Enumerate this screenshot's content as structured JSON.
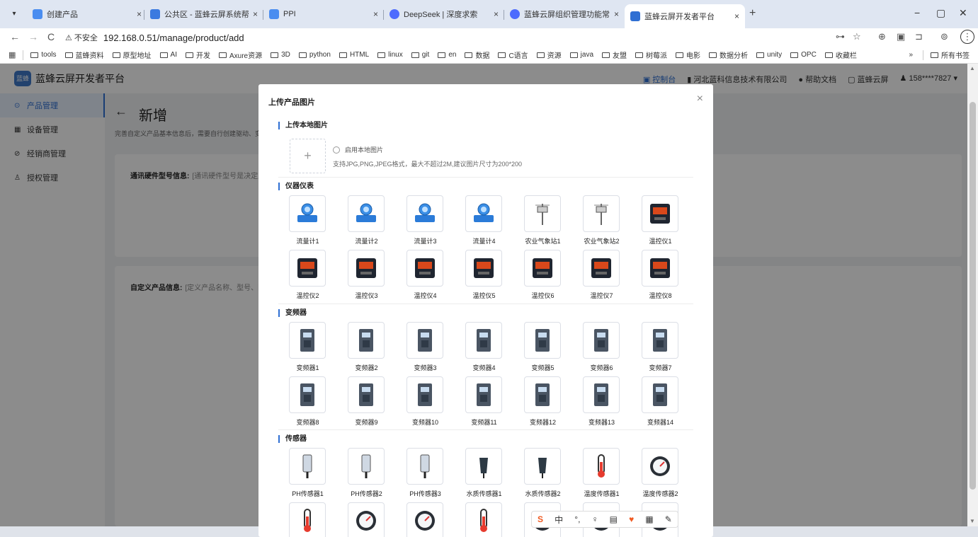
{
  "browser": {
    "tabs": [
      {
        "label": "创建产品",
        "color": "#4a8df0"
      },
      {
        "label": "公共区 - 蓝蜂云屏系统帮助中心",
        "color": "#3b7ae0"
      },
      {
        "label": "PPI",
        "color": "#4a8df0"
      },
      {
        "label": "DeepSeek | 深度求索",
        "color": "#4d6bfe"
      },
      {
        "label": "蓝蜂云屏组织管理功能常见问题",
        "color": "#4d6bfe"
      },
      {
        "label": "蓝蜂云屏开发者平台",
        "color": "#2f6fd3"
      }
    ],
    "tab_close": "×",
    "new_tab": "+",
    "win_min": "−",
    "win_max": "▢",
    "win_close": "✕",
    "back": "←",
    "forward": "→",
    "reload": "C",
    "insecure_label": "不安全",
    "url": "192.168.0.51/manage/product/add",
    "bookmarks": [
      "tools",
      "蓝蜂资料",
      "原型地址",
      "AI",
      "开发",
      "Axure资源",
      "3D",
      "python",
      "HTML",
      "linux",
      "git",
      "en",
      "数据",
      "C语言",
      "资源",
      "java",
      "友盟",
      "树莓派",
      "电影",
      "数据分析",
      "unity",
      "OPC",
      "收藏栏"
    ],
    "bookmarks_more": "»",
    "all_bookmarks": "所有书签"
  },
  "app": {
    "title": "蓝蜂云屏开发者平台",
    "logo_text": "蓝蜂",
    "header_links": {
      "console": "控制台",
      "company": "河北蓝科信息技术有限公司",
      "help": "帮助文档",
      "cloud": "蓝蜂云屏",
      "user": "158****7827"
    },
    "sidebar": [
      {
        "label": "产品管理",
        "icon": "⊙"
      },
      {
        "label": "设备管理",
        "icon": "▦"
      },
      {
        "label": "经销商管理",
        "icon": "⊘"
      },
      {
        "label": "授权管理",
        "icon": "♙"
      }
    ],
    "page": {
      "back": "←",
      "title": "新增",
      "desc": "完善自定义产品基本信息后，需要自行创建驱动、变量",
      "section1_label": "通讯硬件型号信息:",
      "section1_hint": "[通讯硬件型号是决定产品",
      "section2_label": "自定义产品信息:",
      "section2_hint": "[定义产品名称、型号、图片"
    }
  },
  "modal": {
    "title": "上传产品图片",
    "close": "×",
    "local_section": "上传本地图片",
    "upload_plus": "+",
    "enable_local": "启用本地图片",
    "upload_tip": "支持JPG,PNG,JPEG格式，最大不超过2M,建议图片尺寸为200*200",
    "categories": [
      {
        "title": "仪器仪表",
        "items": [
          "流量计1",
          "流量计2",
          "流量计3",
          "流量计4",
          "农业气象站1",
          "农业气象站2",
          "温控仪1",
          "温控仪2",
          "温控仪3",
          "温控仪4",
          "温控仪5",
          "温控仪6",
          "温控仪7",
          "温控仪8"
        ]
      },
      {
        "title": "变频器",
        "items": [
          "变频器1",
          "变频器2",
          "变频器3",
          "变频器4",
          "变频器5",
          "变频器6",
          "变频器7",
          "变频器8",
          "变频器9",
          "变频器10",
          "变频器11",
          "变频器12",
          "变频器13",
          "变频器14"
        ]
      },
      {
        "title": "传感器",
        "items": [
          "PH传感器1",
          "PH传感器2",
          "PH传感器3",
          "水质传感器1",
          "水质传感器2",
          "温度传感器1",
          "温度传感器2",
          "",
          "",
          "",
          "",
          "",
          "",
          ""
        ]
      }
    ]
  },
  "ime": {
    "logo": "S",
    "lang": "中",
    "punct": "°,",
    "mic": "♀",
    "kbd": "▤",
    "skin": "♥",
    "apps": "▦",
    "more": "✎"
  }
}
